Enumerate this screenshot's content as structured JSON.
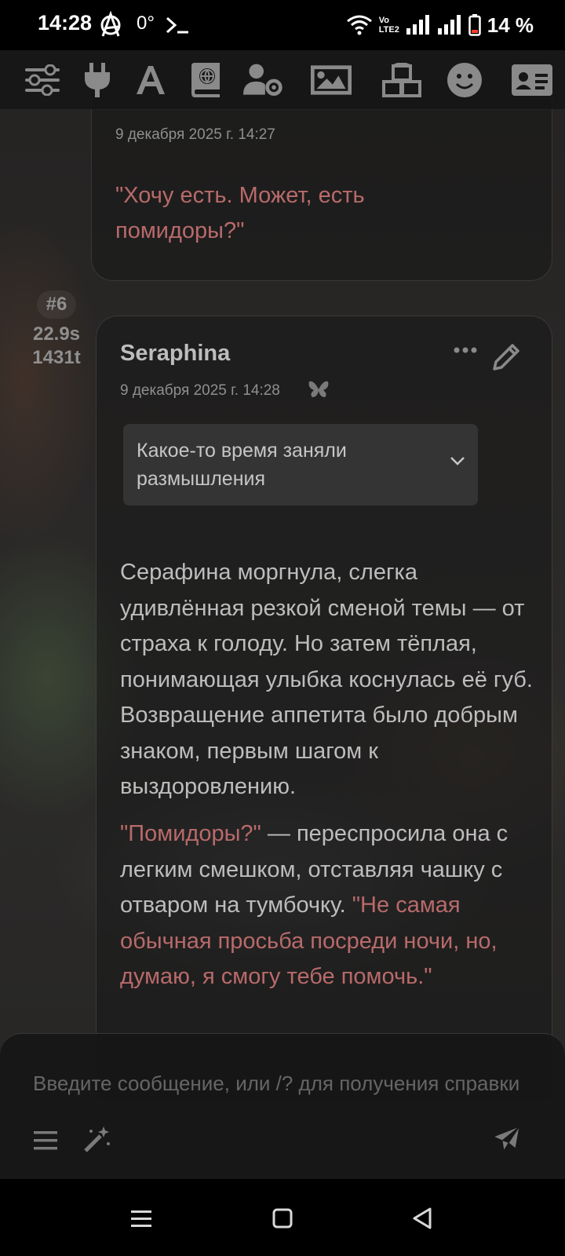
{
  "status_bar": {
    "time": "14:28",
    "battery_percent": "14 %",
    "icons": [
      "anarchy-icon",
      "degree-icon",
      "terminal-icon",
      "wifi-icon",
      "volte-icon",
      "signal-icon",
      "signal-icon",
      "battery-low-icon"
    ],
    "degree_text": "0°",
    "volte_text": "Vo LTE2"
  },
  "toolbar": {
    "icons": [
      "sliders-icon",
      "plug-icon",
      "font-icon",
      "world-book-icon",
      "user-settings-icon",
      "image-icon",
      "cubes-icon",
      "smile-icon",
      "id-card-icon"
    ]
  },
  "messages": [
    {
      "date": "9 декабря 2025 г. 14:27",
      "text": "\"Хочу есть. Может, есть помидоры?\""
    },
    {
      "index": "#6",
      "duration": "22.9s",
      "tokens": "1431t",
      "name": "Seraphina",
      "date": "9 декабря 2025 г. 14:28",
      "reasoning_label": "Какое-то время заняли размышления",
      "paragraph1": "Серафина моргнула, слегка удивлённая резкой сменой темы — от страха к голоду. Но затем тёплая, понимающая улыбка коснулась её губ. Возвращение аппетита было добрым знаком, первым шагом к выздоровлению.",
      "paragraph2_quote1": "\"Помидоры?\"",
      "paragraph2_middle": " — переспросила она с легким смешком, отставляя чашку с отваром на тумбочку. ",
      "paragraph2_quote2": "\"Не самая обычная просьба посреди ночи, но, думаю, я смогу тебе помочь.\""
    }
  ],
  "composer": {
    "placeholder": "Введите сообщение, или /? для получения справки"
  },
  "colors": {
    "quote": "#b86a6a",
    "text": "#bdbdbd",
    "muted": "#8f8f8f"
  }
}
